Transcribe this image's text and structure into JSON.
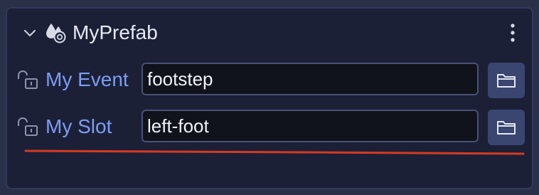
{
  "colors": {
    "panel_background": "#1b2037",
    "panel_border": "#313a5c",
    "label_color": "#7d9cf2",
    "field_background": "#10121c",
    "field_border": "#4a5274",
    "button_background": "#3a4670",
    "annotation_line": "#d63a22"
  },
  "component": {
    "title": "MyPrefab",
    "expanded": true,
    "icons": {
      "collapse": "chevron-down-icon",
      "prefab": "prefab-icon",
      "menu": "more-vertical-icon"
    }
  },
  "fields": [
    {
      "label": "My Event",
      "value": "footstep",
      "locked": false,
      "lock_icon": "unlock-icon",
      "browse_icon": "folder-icon"
    },
    {
      "label": "My Slot",
      "value": "left-foot",
      "locked": false,
      "lock_icon": "unlock-icon",
      "browse_icon": "folder-icon"
    }
  ]
}
